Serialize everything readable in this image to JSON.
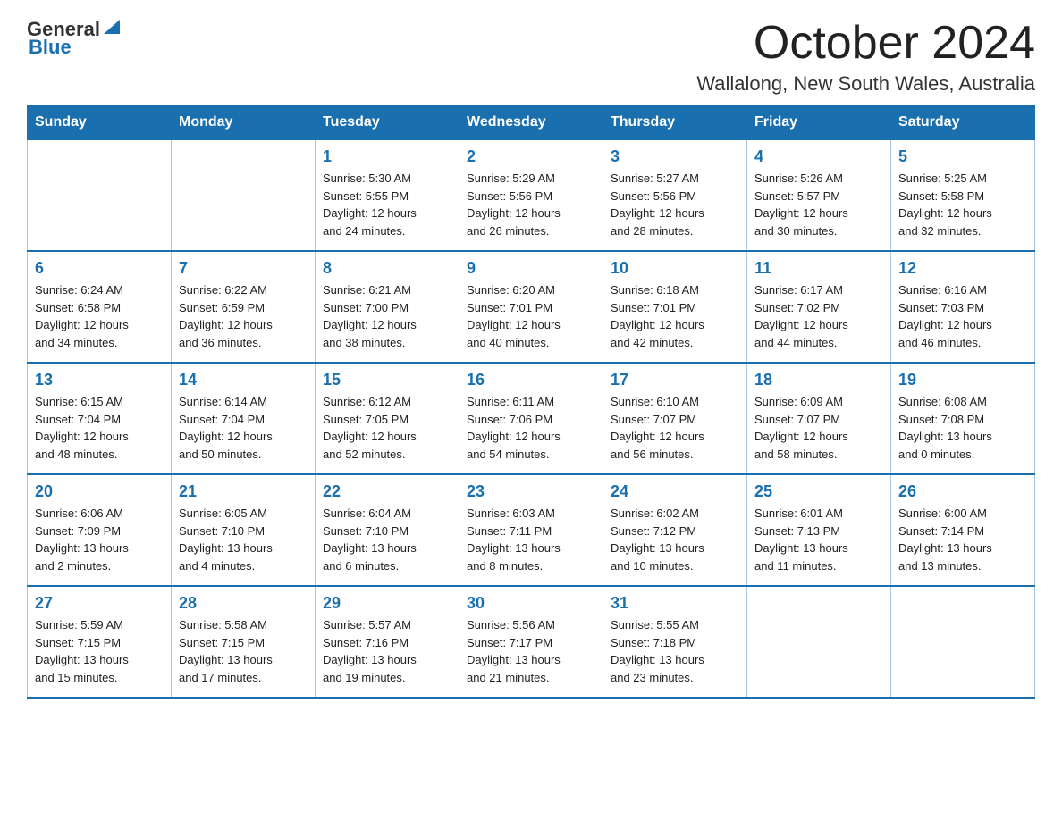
{
  "header": {
    "logo_general": "General",
    "logo_blue": "Blue",
    "month_year": "October 2024",
    "location": "Wallalong, New South Wales, Australia"
  },
  "weekdays": [
    "Sunday",
    "Monday",
    "Tuesday",
    "Wednesday",
    "Thursday",
    "Friday",
    "Saturday"
  ],
  "weeks": [
    [
      {
        "day": "",
        "details": ""
      },
      {
        "day": "",
        "details": ""
      },
      {
        "day": "1",
        "details": "Sunrise: 5:30 AM\nSunset: 5:55 PM\nDaylight: 12 hours\nand 24 minutes."
      },
      {
        "day": "2",
        "details": "Sunrise: 5:29 AM\nSunset: 5:56 PM\nDaylight: 12 hours\nand 26 minutes."
      },
      {
        "day": "3",
        "details": "Sunrise: 5:27 AM\nSunset: 5:56 PM\nDaylight: 12 hours\nand 28 minutes."
      },
      {
        "day": "4",
        "details": "Sunrise: 5:26 AM\nSunset: 5:57 PM\nDaylight: 12 hours\nand 30 minutes."
      },
      {
        "day": "5",
        "details": "Sunrise: 5:25 AM\nSunset: 5:58 PM\nDaylight: 12 hours\nand 32 minutes."
      }
    ],
    [
      {
        "day": "6",
        "details": "Sunrise: 6:24 AM\nSunset: 6:58 PM\nDaylight: 12 hours\nand 34 minutes."
      },
      {
        "day": "7",
        "details": "Sunrise: 6:22 AM\nSunset: 6:59 PM\nDaylight: 12 hours\nand 36 minutes."
      },
      {
        "day": "8",
        "details": "Sunrise: 6:21 AM\nSunset: 7:00 PM\nDaylight: 12 hours\nand 38 minutes."
      },
      {
        "day": "9",
        "details": "Sunrise: 6:20 AM\nSunset: 7:01 PM\nDaylight: 12 hours\nand 40 minutes."
      },
      {
        "day": "10",
        "details": "Sunrise: 6:18 AM\nSunset: 7:01 PM\nDaylight: 12 hours\nand 42 minutes."
      },
      {
        "day": "11",
        "details": "Sunrise: 6:17 AM\nSunset: 7:02 PM\nDaylight: 12 hours\nand 44 minutes."
      },
      {
        "day": "12",
        "details": "Sunrise: 6:16 AM\nSunset: 7:03 PM\nDaylight: 12 hours\nand 46 minutes."
      }
    ],
    [
      {
        "day": "13",
        "details": "Sunrise: 6:15 AM\nSunset: 7:04 PM\nDaylight: 12 hours\nand 48 minutes."
      },
      {
        "day": "14",
        "details": "Sunrise: 6:14 AM\nSunset: 7:04 PM\nDaylight: 12 hours\nand 50 minutes."
      },
      {
        "day": "15",
        "details": "Sunrise: 6:12 AM\nSunset: 7:05 PM\nDaylight: 12 hours\nand 52 minutes."
      },
      {
        "day": "16",
        "details": "Sunrise: 6:11 AM\nSunset: 7:06 PM\nDaylight: 12 hours\nand 54 minutes."
      },
      {
        "day": "17",
        "details": "Sunrise: 6:10 AM\nSunset: 7:07 PM\nDaylight: 12 hours\nand 56 minutes."
      },
      {
        "day": "18",
        "details": "Sunrise: 6:09 AM\nSunset: 7:07 PM\nDaylight: 12 hours\nand 58 minutes."
      },
      {
        "day": "19",
        "details": "Sunrise: 6:08 AM\nSunset: 7:08 PM\nDaylight: 13 hours\nand 0 minutes."
      }
    ],
    [
      {
        "day": "20",
        "details": "Sunrise: 6:06 AM\nSunset: 7:09 PM\nDaylight: 13 hours\nand 2 minutes."
      },
      {
        "day": "21",
        "details": "Sunrise: 6:05 AM\nSunset: 7:10 PM\nDaylight: 13 hours\nand 4 minutes."
      },
      {
        "day": "22",
        "details": "Sunrise: 6:04 AM\nSunset: 7:10 PM\nDaylight: 13 hours\nand 6 minutes."
      },
      {
        "day": "23",
        "details": "Sunrise: 6:03 AM\nSunset: 7:11 PM\nDaylight: 13 hours\nand 8 minutes."
      },
      {
        "day": "24",
        "details": "Sunrise: 6:02 AM\nSunset: 7:12 PM\nDaylight: 13 hours\nand 10 minutes."
      },
      {
        "day": "25",
        "details": "Sunrise: 6:01 AM\nSunset: 7:13 PM\nDaylight: 13 hours\nand 11 minutes."
      },
      {
        "day": "26",
        "details": "Sunrise: 6:00 AM\nSunset: 7:14 PM\nDaylight: 13 hours\nand 13 minutes."
      }
    ],
    [
      {
        "day": "27",
        "details": "Sunrise: 5:59 AM\nSunset: 7:15 PM\nDaylight: 13 hours\nand 15 minutes."
      },
      {
        "day": "28",
        "details": "Sunrise: 5:58 AM\nSunset: 7:15 PM\nDaylight: 13 hours\nand 17 minutes."
      },
      {
        "day": "29",
        "details": "Sunrise: 5:57 AM\nSunset: 7:16 PM\nDaylight: 13 hours\nand 19 minutes."
      },
      {
        "day": "30",
        "details": "Sunrise: 5:56 AM\nSunset: 7:17 PM\nDaylight: 13 hours\nand 21 minutes."
      },
      {
        "day": "31",
        "details": "Sunrise: 5:55 AM\nSunset: 7:18 PM\nDaylight: 13 hours\nand 23 minutes."
      },
      {
        "day": "",
        "details": ""
      },
      {
        "day": "",
        "details": ""
      }
    ]
  ]
}
